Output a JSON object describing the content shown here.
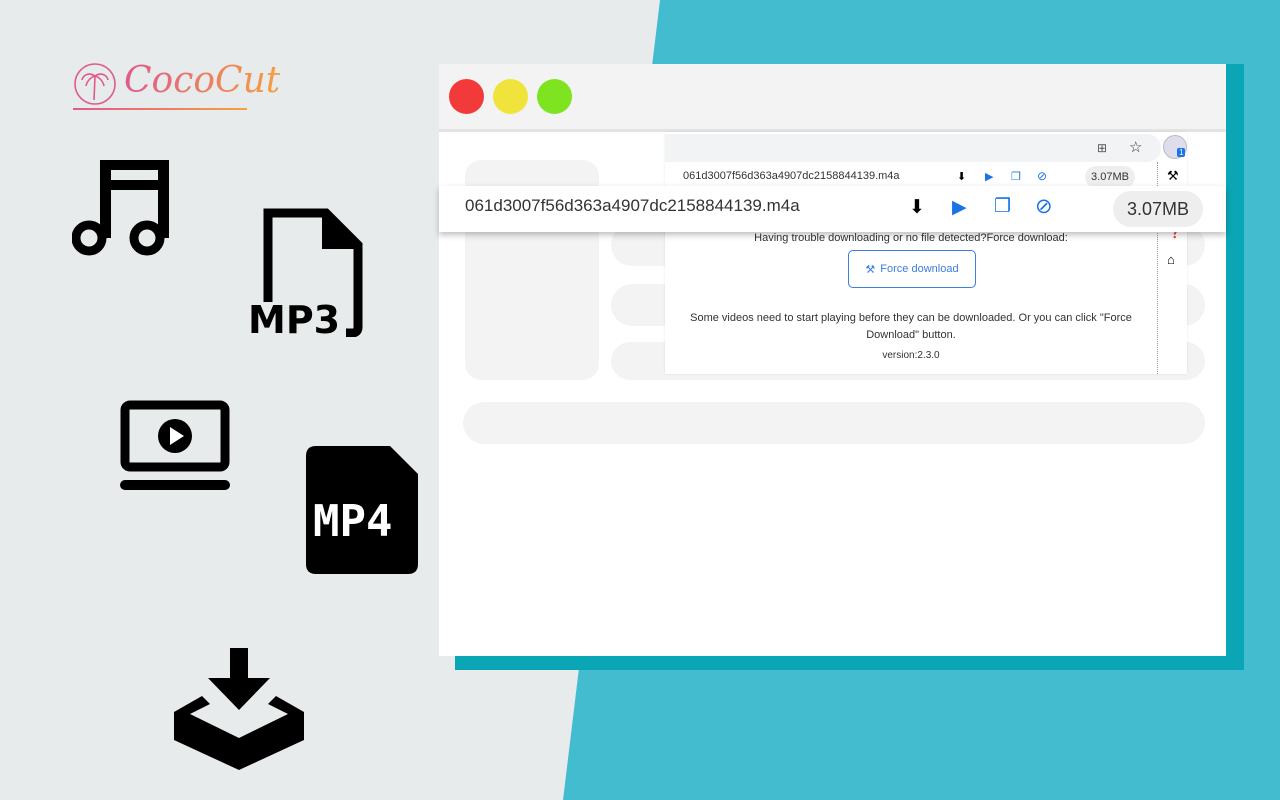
{
  "brand": {
    "name": "CocoCut"
  },
  "feature_icons": [
    "music-note-icon",
    "mp3-file-icon",
    "laptop-play-icon",
    "mp4-file-icon",
    "download-tray-icon"
  ],
  "feature_labels": {
    "mp3": "MP3",
    "mp4": "MP4"
  },
  "colors": {
    "teal": "#44bcd0",
    "teal_dark": "#0aa6b5",
    "close": "#f23a3a",
    "minimize": "#f0e43c",
    "maximize": "#7ee41f",
    "accent": "#3c7de0"
  },
  "popup": {
    "file_name": "061d3007f56d363a4907dc2158844139.m4a",
    "file_size": "3.07MB",
    "trouble_text": "Having trouble downloading or no file detected?Force download:",
    "force_button": "Force download",
    "note": "Some videos need to start playing before they can be downloaded. Or you can click \"Force Download\" button.",
    "version": "version:2.3.0",
    "extension_badge": "1"
  },
  "highlight": {
    "file_name": "061d3007f56d363a4907dc2158844139.m4a",
    "file_size": "3.07MB"
  }
}
